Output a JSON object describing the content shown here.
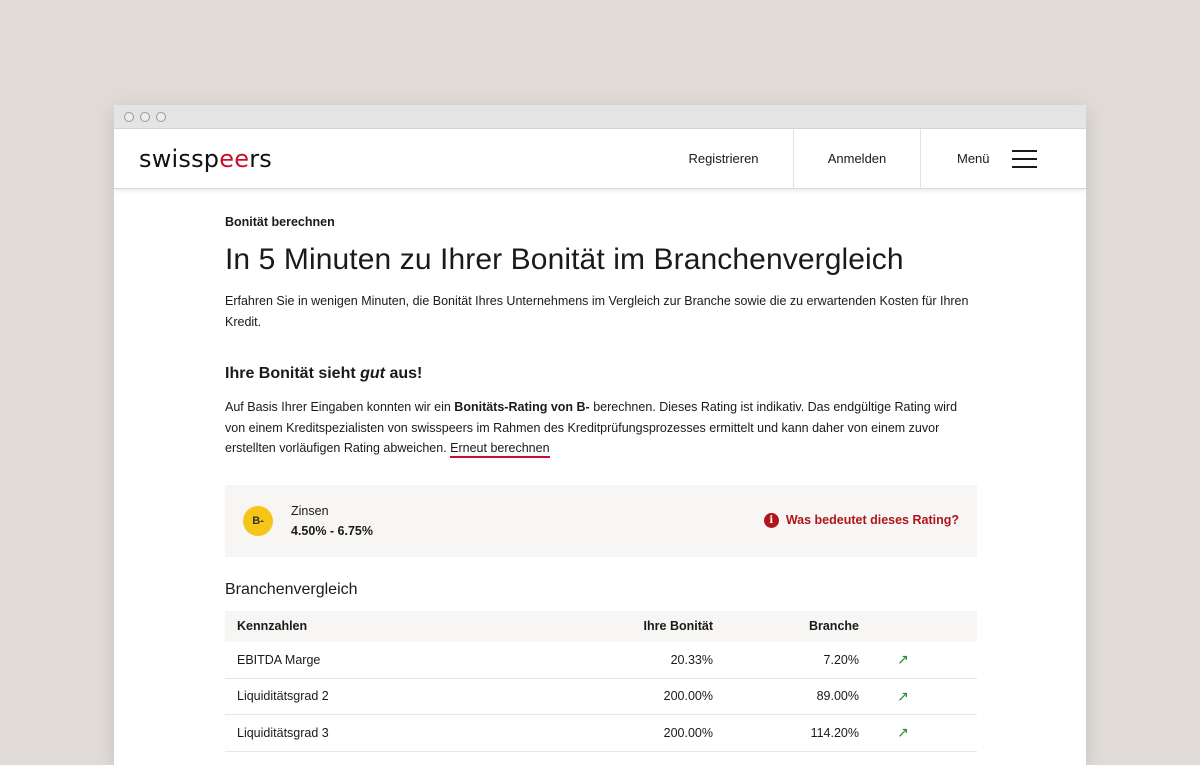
{
  "window": {
    "dots": 3
  },
  "header": {
    "logo": {
      "part1": "swissp",
      "part2": "ee",
      "part3": "rs"
    },
    "nav": {
      "register": "Registrieren",
      "login": "Anmelden",
      "menu": "Menü"
    }
  },
  "main": {
    "kicker": "Bonität berechnen",
    "title": "In 5 Minuten zu Ihrer Bonität im Branchenvergleich",
    "intro": "Erfahren Sie in wenigen Minuten, die Bonität Ihres Unternehmens im Vergleich zur Branche sowie die zu erwartenden Kosten für Ihren Kredit.",
    "result_heading": {
      "prefix": "Ihre Bonität sieht ",
      "emph": "gut",
      "suffix": " aus!"
    },
    "result_text": {
      "p1": "Auf Basis Ihrer Eingaben konnten wir ein ",
      "bold": "Bonitäts-Rating von B-",
      "p2": " berechnen. Dieses Rating ist indikativ. Das endgültige Rating wird von einem Kreditspezialisten von swisspeers im Rahmen des Kreditprüfungsprozesses ermittelt und kann daher von einem zuvor erstellten vorläufigen Rating abweichen. ",
      "link": "Erneut berechnen"
    },
    "rating": {
      "badge": "B-",
      "label": "Zinsen",
      "value": "4.50% - 6.75%",
      "help_link": "Was bedeutet dieses Rating?",
      "help_icon": "info-icon",
      "badge_color": "#f5c518",
      "accent_color": "#b0151b"
    },
    "comparison": {
      "title": "Branchenvergleich",
      "headers": {
        "name": "Kennzahlen",
        "own": "Ihre Bonität",
        "branch": "Branche"
      },
      "rows": [
        {
          "name": "EBITDA Marge",
          "own": "20.33%",
          "branch": "7.20%",
          "trend": "↗"
        },
        {
          "name": "Liquiditätsgrad 2",
          "own": "200.00%",
          "branch": "89.00%",
          "trend": "↗"
        },
        {
          "name": "Liquiditätsgrad 3",
          "own": "200.00%",
          "branch": "114.20%",
          "trend": "↗"
        }
      ]
    }
  }
}
